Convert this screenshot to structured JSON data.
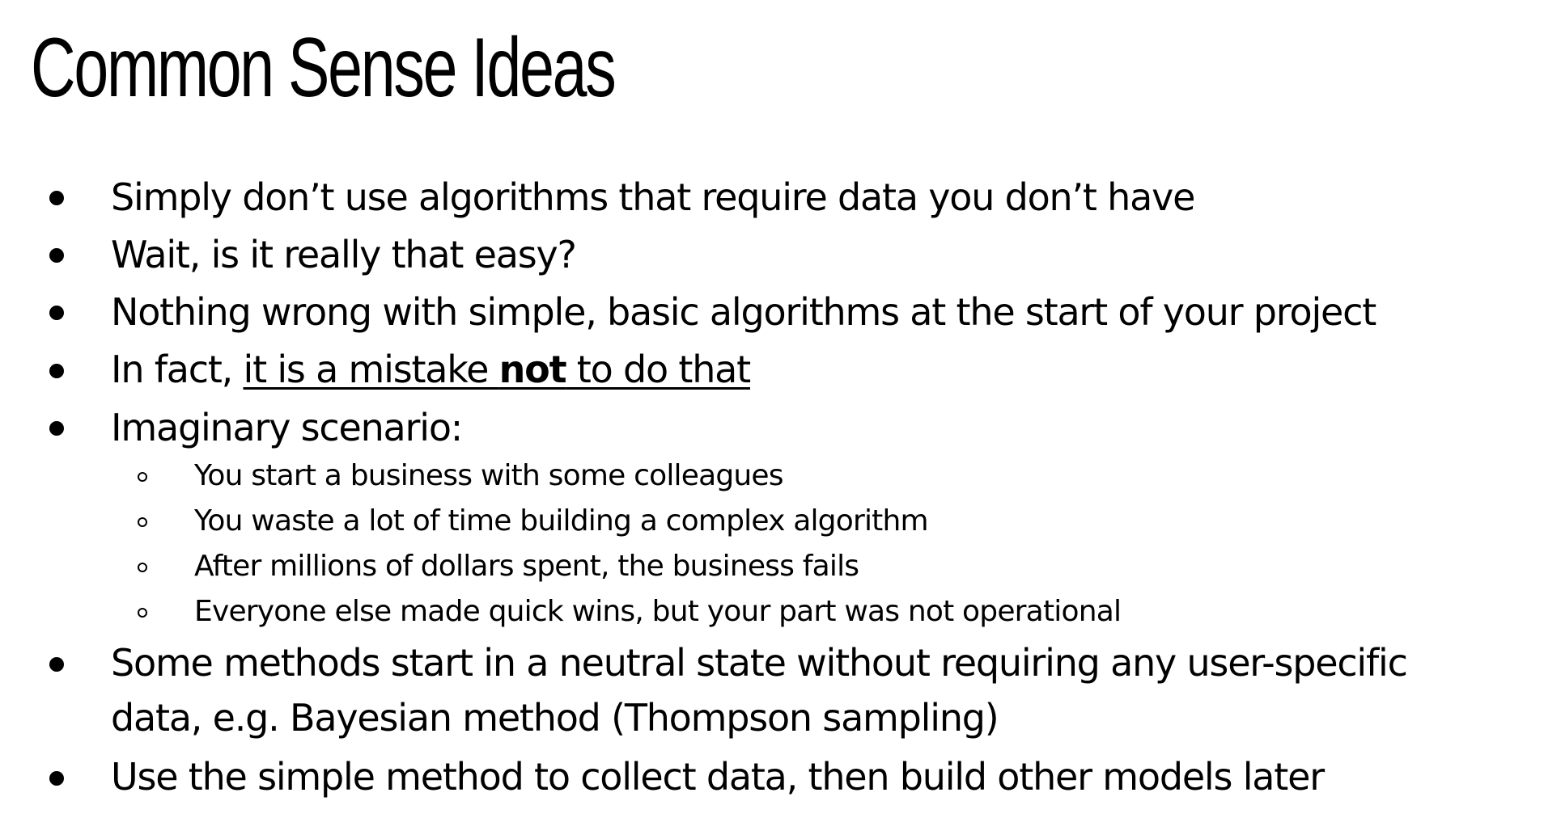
{
  "title": "Common Sense Ideas",
  "bullets": [
    "Simply don’t use algorithms that require data you don’t have",
    "Wait, is it really that easy?",
    "Nothing wrong with simple, basic algorithms at the start of your project",
    {
      "prefix": "In fact, ",
      "underlined_before": "it is a mistake ",
      "bold_underlined": "not",
      "underlined_after": " to do that"
    },
    "Imaginary scenario:",
    "Some methods start in a neutral state without requiring any user-specific",
    "data, e.g. Bayesian method (Thompson sampling)",
    "Use the simple method to collect data, then build other models later"
  ],
  "sub_bullets": [
    "You start a business with some colleagues",
    "You waste a lot of time building a complex algorithm",
    "After millions of dollars spent, the business fails",
    "Everyone else made quick wins, but your part was not operational"
  ]
}
